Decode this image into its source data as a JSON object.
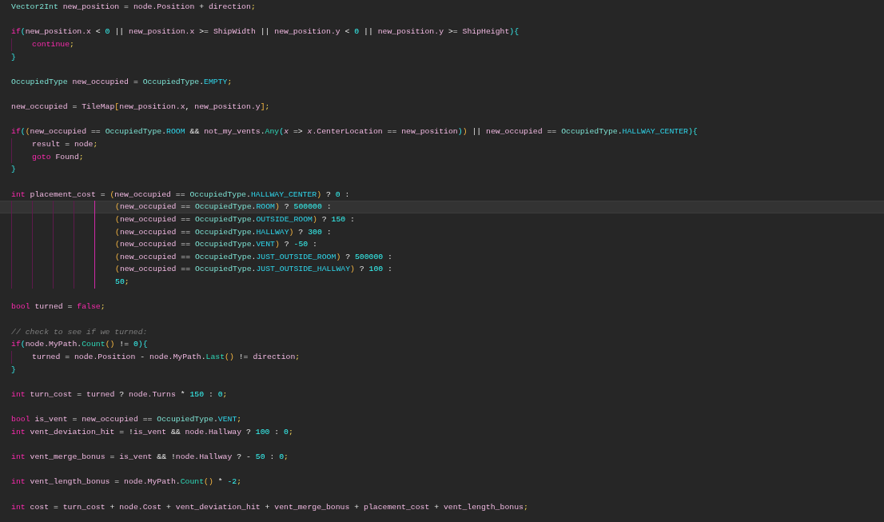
{
  "editor": {
    "lines": [
      {
        "current": false,
        "tokens": [
          {
            "kind": "type",
            "text": "Vector2Int"
          },
          {
            "kind": "id",
            "text": " new_position"
          },
          {
            "kind": "op",
            "text": " = "
          },
          {
            "kind": "id",
            "text": "node.Position"
          },
          {
            "kind": "op",
            "text": " + "
          },
          {
            "kind": "id",
            "text": "direction"
          },
          {
            "kind": "pun",
            "text": ";"
          }
        ]
      },
      {
        "current": false
      },
      {
        "current": false,
        "tokens": [
          {
            "kind": "kw",
            "text": "if"
          },
          {
            "kind": "b2",
            "text": "("
          },
          {
            "kind": "id",
            "text": "new_position.x"
          },
          {
            "kind": "op",
            "text": " < "
          },
          {
            "kind": "num",
            "text": "0"
          },
          {
            "kind": "op",
            "text": " || "
          },
          {
            "kind": "id",
            "text": "new_position.x"
          },
          {
            "kind": "op",
            "text": " >= "
          },
          {
            "kind": "id",
            "text": "ShipWidth"
          },
          {
            "kind": "op",
            "text": " || "
          },
          {
            "kind": "id",
            "text": "new_position.y"
          },
          {
            "kind": "op",
            "text": " < "
          },
          {
            "kind": "num",
            "text": "0"
          },
          {
            "kind": "op",
            "text": " || "
          },
          {
            "kind": "id",
            "text": "new_position.y"
          },
          {
            "kind": "op",
            "text": " >= "
          },
          {
            "kind": "id",
            "text": "ShipHeight"
          },
          {
            "kind": "b2",
            "text": "){"
          }
        ]
      },
      {
        "current": false,
        "guides": [
          {
            "active": false
          }
        ],
        "tokens": [
          {
            "kind": "kw",
            "text": "continue"
          },
          {
            "kind": "pun",
            "text": ";"
          }
        ]
      },
      {
        "current": false,
        "tokens": [
          {
            "kind": "b2",
            "text": "}"
          }
        ]
      },
      {
        "current": false
      },
      {
        "current": false,
        "tokens": [
          {
            "kind": "type",
            "text": "OccupiedType"
          },
          {
            "kind": "id",
            "text": " new_occupied"
          },
          {
            "kind": "op",
            "text": " = "
          },
          {
            "kind": "type",
            "text": "OccupiedType"
          },
          {
            "kind": "op",
            "text": "."
          },
          {
            "kind": "enum",
            "text": "EMPTY"
          },
          {
            "kind": "pun",
            "text": ";"
          }
        ]
      },
      {
        "current": false
      },
      {
        "current": false,
        "tokens": [
          {
            "kind": "id",
            "text": "new_occupied"
          },
          {
            "kind": "op",
            "text": " = "
          },
          {
            "kind": "id",
            "text": "TileMap"
          },
          {
            "kind": "b1",
            "text": "["
          },
          {
            "kind": "id",
            "text": "new_position.x"
          },
          {
            "kind": "op",
            "text": ", "
          },
          {
            "kind": "id",
            "text": "new_position.y"
          },
          {
            "kind": "b1",
            "text": "]"
          },
          {
            "kind": "pun",
            "text": ";"
          }
        ]
      },
      {
        "current": false
      },
      {
        "current": false,
        "tokens": [
          {
            "kind": "kw",
            "text": "if"
          },
          {
            "kind": "b2",
            "text": "("
          },
          {
            "kind": "b1",
            "text": "("
          },
          {
            "kind": "id",
            "text": "new_occupied"
          },
          {
            "kind": "op",
            "text": " == "
          },
          {
            "kind": "type",
            "text": "OccupiedType"
          },
          {
            "kind": "op",
            "text": "."
          },
          {
            "kind": "enum",
            "text": "ROOM"
          },
          {
            "kind": "op",
            "text": " && "
          },
          {
            "kind": "id",
            "text": "not_my_vents"
          },
          {
            "kind": "op",
            "text": "."
          },
          {
            "kind": "fn",
            "text": "Any"
          },
          {
            "kind": "b2",
            "text": "("
          },
          {
            "kind": "param",
            "text": "x"
          },
          {
            "kind": "op",
            "text": " => "
          },
          {
            "kind": "param",
            "text": "x"
          },
          {
            "kind": "id",
            "text": ".CenterLocation"
          },
          {
            "kind": "op",
            "text": " == "
          },
          {
            "kind": "id",
            "text": "new_position"
          },
          {
            "kind": "b2",
            "text": ")"
          },
          {
            "kind": "b1",
            "text": ")"
          },
          {
            "kind": "op",
            "text": " || "
          },
          {
            "kind": "id",
            "text": "new_occupied"
          },
          {
            "kind": "op",
            "text": " == "
          },
          {
            "kind": "type",
            "text": "OccupiedType"
          },
          {
            "kind": "op",
            "text": "."
          },
          {
            "kind": "enum",
            "text": "HALLWAY_CENTER"
          },
          {
            "kind": "b2",
            "text": "){"
          }
        ]
      },
      {
        "current": false,
        "guides": [
          {
            "active": false
          }
        ],
        "tokens": [
          {
            "kind": "id",
            "text": "result"
          },
          {
            "kind": "op",
            "text": " = "
          },
          {
            "kind": "id",
            "text": "node"
          },
          {
            "kind": "pun",
            "text": ";"
          }
        ]
      },
      {
        "current": false,
        "guides": [
          {
            "active": false
          }
        ],
        "tokens": [
          {
            "kind": "kw",
            "text": "goto"
          },
          {
            "kind": "id",
            "text": " Found"
          },
          {
            "kind": "pun",
            "text": ";"
          }
        ]
      },
      {
        "current": false,
        "tokens": [
          {
            "kind": "b2",
            "text": "}"
          }
        ]
      },
      {
        "current": false
      },
      {
        "current": false,
        "tokens": [
          {
            "kind": "kw",
            "text": "int"
          },
          {
            "kind": "id",
            "text": " placement_cost"
          },
          {
            "kind": "op",
            "text": " = "
          },
          {
            "kind": "b1",
            "text": "("
          },
          {
            "kind": "id",
            "text": "new_occupied"
          },
          {
            "kind": "op",
            "text": " == "
          },
          {
            "kind": "type",
            "text": "OccupiedType"
          },
          {
            "kind": "op",
            "text": "."
          },
          {
            "kind": "enum",
            "text": "HALLWAY_CENTER"
          },
          {
            "kind": "b1",
            "text": ")"
          },
          {
            "kind": "op",
            "text": " ? "
          },
          {
            "kind": "num",
            "text": "0"
          },
          {
            "kind": "op",
            "text": " :"
          }
        ]
      },
      {
        "current": true,
        "guides": [
          {
            "active": false
          },
          {
            "active": false
          },
          {
            "active": false
          },
          {
            "active": false
          },
          {
            "active": true
          }
        ],
        "tokens": [
          {
            "kind": "b1",
            "text": "("
          },
          {
            "kind": "id",
            "text": "new_occupied"
          },
          {
            "kind": "op",
            "text": " == "
          },
          {
            "kind": "type",
            "text": "OccupiedType"
          },
          {
            "kind": "op",
            "text": "."
          },
          {
            "kind": "enum",
            "text": "ROOM"
          },
          {
            "kind": "b1",
            "text": ")"
          },
          {
            "kind": "op",
            "text": " ? "
          },
          {
            "kind": "num",
            "text": "500000"
          },
          {
            "kind": "op",
            "text": " :"
          }
        ]
      },
      {
        "current": false,
        "guides": [
          {
            "active": false
          },
          {
            "active": false
          },
          {
            "active": false
          },
          {
            "active": false
          },
          {
            "active": true
          }
        ],
        "tokens": [
          {
            "kind": "b1",
            "text": "("
          },
          {
            "kind": "id",
            "text": "new_occupied"
          },
          {
            "kind": "op",
            "text": " == "
          },
          {
            "kind": "type",
            "text": "OccupiedType"
          },
          {
            "kind": "op",
            "text": "."
          },
          {
            "kind": "enum",
            "text": "OUTSIDE_ROOM"
          },
          {
            "kind": "b1",
            "text": ")"
          },
          {
            "kind": "op",
            "text": " ? "
          },
          {
            "kind": "num",
            "text": "150"
          },
          {
            "kind": "op",
            "text": " :"
          }
        ]
      },
      {
        "current": false,
        "guides": [
          {
            "active": false
          },
          {
            "active": false
          },
          {
            "active": false
          },
          {
            "active": false
          },
          {
            "active": true
          }
        ],
        "tokens": [
          {
            "kind": "b1",
            "text": "("
          },
          {
            "kind": "id",
            "text": "new_occupied"
          },
          {
            "kind": "op",
            "text": " == "
          },
          {
            "kind": "type",
            "text": "OccupiedType"
          },
          {
            "kind": "op",
            "text": "."
          },
          {
            "kind": "enum",
            "text": "HALLWAY"
          },
          {
            "kind": "b1",
            "text": ")"
          },
          {
            "kind": "op",
            "text": " ? "
          },
          {
            "kind": "num",
            "text": "300"
          },
          {
            "kind": "op",
            "text": " :"
          }
        ]
      },
      {
        "current": false,
        "guides": [
          {
            "active": false
          },
          {
            "active": false
          },
          {
            "active": false
          },
          {
            "active": false
          },
          {
            "active": true
          }
        ],
        "tokens": [
          {
            "kind": "b1",
            "text": "("
          },
          {
            "kind": "id",
            "text": "new_occupied"
          },
          {
            "kind": "op",
            "text": " == "
          },
          {
            "kind": "type",
            "text": "OccupiedType"
          },
          {
            "kind": "op",
            "text": "."
          },
          {
            "kind": "enum",
            "text": "VENT"
          },
          {
            "kind": "b1",
            "text": ")"
          },
          {
            "kind": "op",
            "text": " ? "
          },
          {
            "kind": "num",
            "text": "-50"
          },
          {
            "kind": "op",
            "text": " :"
          }
        ]
      },
      {
        "current": false,
        "guides": [
          {
            "active": false
          },
          {
            "active": false
          },
          {
            "active": false
          },
          {
            "active": false
          },
          {
            "active": true
          }
        ],
        "tokens": [
          {
            "kind": "b1",
            "text": "("
          },
          {
            "kind": "id",
            "text": "new_occupied"
          },
          {
            "kind": "op",
            "text": " == "
          },
          {
            "kind": "type",
            "text": "OccupiedType"
          },
          {
            "kind": "op",
            "text": "."
          },
          {
            "kind": "enum",
            "text": "JUST_OUTSIDE_ROOM"
          },
          {
            "kind": "b1",
            "text": ")"
          },
          {
            "kind": "op",
            "text": " ? "
          },
          {
            "kind": "num",
            "text": "500000"
          },
          {
            "kind": "op",
            "text": " :"
          }
        ]
      },
      {
        "current": false,
        "guides": [
          {
            "active": false
          },
          {
            "active": false
          },
          {
            "active": false
          },
          {
            "active": false
          },
          {
            "active": true
          }
        ],
        "tokens": [
          {
            "kind": "b1",
            "text": "("
          },
          {
            "kind": "id",
            "text": "new_occupied"
          },
          {
            "kind": "op",
            "text": " == "
          },
          {
            "kind": "type",
            "text": "OccupiedType"
          },
          {
            "kind": "op",
            "text": "."
          },
          {
            "kind": "enum",
            "text": "JUST_OUTSIDE_HALLWAY"
          },
          {
            "kind": "b1",
            "text": ")"
          },
          {
            "kind": "op",
            "text": " ? "
          },
          {
            "kind": "num",
            "text": "100"
          },
          {
            "kind": "op",
            "text": " :"
          }
        ]
      },
      {
        "current": false,
        "guides": [
          {
            "active": false
          },
          {
            "active": false
          },
          {
            "active": false
          },
          {
            "active": false
          },
          {
            "active": true
          }
        ],
        "tokens": [
          {
            "kind": "num",
            "text": "50"
          },
          {
            "kind": "pun",
            "text": ";"
          }
        ]
      },
      {
        "current": false
      },
      {
        "current": false,
        "tokens": [
          {
            "kind": "kw",
            "text": "bool"
          },
          {
            "kind": "id",
            "text": " turned"
          },
          {
            "kind": "op",
            "text": " = "
          },
          {
            "kind": "kw",
            "text": "false"
          },
          {
            "kind": "pun",
            "text": ";"
          }
        ]
      },
      {
        "current": false
      },
      {
        "current": false,
        "tokens": [
          {
            "kind": "cm",
            "text": "// check to see if we turned:"
          }
        ]
      },
      {
        "current": false,
        "tokens": [
          {
            "kind": "kw",
            "text": "if"
          },
          {
            "kind": "b2",
            "text": "("
          },
          {
            "kind": "id",
            "text": "node.MyPath"
          },
          {
            "kind": "op",
            "text": "."
          },
          {
            "kind": "fn",
            "text": "Count"
          },
          {
            "kind": "b1",
            "text": "()"
          },
          {
            "kind": "op",
            "text": " != "
          },
          {
            "kind": "num",
            "text": "0"
          },
          {
            "kind": "b2",
            "text": "){"
          }
        ]
      },
      {
        "current": false,
        "guides": [
          {
            "active": false
          }
        ],
        "tokens": [
          {
            "kind": "id",
            "text": "turned"
          },
          {
            "kind": "op",
            "text": " = "
          },
          {
            "kind": "id",
            "text": "node.Position"
          },
          {
            "kind": "op",
            "text": " - "
          },
          {
            "kind": "id",
            "text": "node.MyPath"
          },
          {
            "kind": "op",
            "text": "."
          },
          {
            "kind": "fn",
            "text": "Last"
          },
          {
            "kind": "b1",
            "text": "()"
          },
          {
            "kind": "op",
            "text": " != "
          },
          {
            "kind": "id",
            "text": "direction"
          },
          {
            "kind": "pun",
            "text": ";"
          }
        ]
      },
      {
        "current": false,
        "tokens": [
          {
            "kind": "b2",
            "text": "}"
          }
        ]
      },
      {
        "current": false
      },
      {
        "current": false,
        "tokens": [
          {
            "kind": "kw",
            "text": "int"
          },
          {
            "kind": "id",
            "text": " turn_cost"
          },
          {
            "kind": "op",
            "text": " = "
          },
          {
            "kind": "id",
            "text": "turned"
          },
          {
            "kind": "op",
            "text": " ? "
          },
          {
            "kind": "id",
            "text": "node.Turns"
          },
          {
            "kind": "op",
            "text": " * "
          },
          {
            "kind": "num",
            "text": "150"
          },
          {
            "kind": "op",
            "text": " : "
          },
          {
            "kind": "num",
            "text": "0"
          },
          {
            "kind": "pun",
            "text": ";"
          }
        ]
      },
      {
        "current": false
      },
      {
        "current": false,
        "tokens": [
          {
            "kind": "kw",
            "text": "bool"
          },
          {
            "kind": "id",
            "text": " is_vent"
          },
          {
            "kind": "op",
            "text": " = "
          },
          {
            "kind": "id",
            "text": "new_occupied"
          },
          {
            "kind": "op",
            "text": " == "
          },
          {
            "kind": "type",
            "text": "OccupiedType"
          },
          {
            "kind": "op",
            "text": "."
          },
          {
            "kind": "enum",
            "text": "VENT"
          },
          {
            "kind": "pun",
            "text": ";"
          }
        ]
      },
      {
        "current": false,
        "tokens": [
          {
            "kind": "kw",
            "text": "int"
          },
          {
            "kind": "id",
            "text": " vent_deviation_hit"
          },
          {
            "kind": "op",
            "text": " = !"
          },
          {
            "kind": "id",
            "text": "is_vent"
          },
          {
            "kind": "op",
            "text": " && "
          },
          {
            "kind": "id",
            "text": "node.Hallway"
          },
          {
            "kind": "op",
            "text": " ? "
          },
          {
            "kind": "num",
            "text": "100"
          },
          {
            "kind": "op",
            "text": " : "
          },
          {
            "kind": "num",
            "text": "0"
          },
          {
            "kind": "pun",
            "text": ";"
          }
        ]
      },
      {
        "current": false
      },
      {
        "current": false,
        "tokens": [
          {
            "kind": "kw",
            "text": "int"
          },
          {
            "kind": "id",
            "text": " vent_merge_bonus"
          },
          {
            "kind": "op",
            "text": " = "
          },
          {
            "kind": "id",
            "text": "is_vent"
          },
          {
            "kind": "op",
            "text": " && !"
          },
          {
            "kind": "id",
            "text": "node.Hallway"
          },
          {
            "kind": "op",
            "text": " ? - "
          },
          {
            "kind": "num",
            "text": "50"
          },
          {
            "kind": "op",
            "text": " : "
          },
          {
            "kind": "num",
            "text": "0"
          },
          {
            "kind": "pun",
            "text": ";"
          }
        ]
      },
      {
        "current": false
      },
      {
        "current": false,
        "tokens": [
          {
            "kind": "kw",
            "text": "int"
          },
          {
            "kind": "id",
            "text": " vent_length_bonus"
          },
          {
            "kind": "op",
            "text": " = "
          },
          {
            "kind": "id",
            "text": "node.MyPath"
          },
          {
            "kind": "op",
            "text": "."
          },
          {
            "kind": "fn",
            "text": "Count"
          },
          {
            "kind": "b1",
            "text": "()"
          },
          {
            "kind": "op",
            "text": " * "
          },
          {
            "kind": "num",
            "text": "-2"
          },
          {
            "kind": "pun",
            "text": ";"
          }
        ]
      },
      {
        "current": false
      },
      {
        "current": false,
        "tokens": [
          {
            "kind": "kw",
            "text": "int"
          },
          {
            "kind": "id",
            "text": " cost"
          },
          {
            "kind": "op",
            "text": " = "
          },
          {
            "kind": "id",
            "text": "turn_cost"
          },
          {
            "kind": "op",
            "text": " + "
          },
          {
            "kind": "id",
            "text": "node.Cost"
          },
          {
            "kind": "op",
            "text": " + "
          },
          {
            "kind": "id",
            "text": "vent_deviation_hit"
          },
          {
            "kind": "op",
            "text": " + "
          },
          {
            "kind": "id",
            "text": "vent_merge_bonus"
          },
          {
            "kind": "op",
            "text": " + "
          },
          {
            "kind": "id",
            "text": "placement_cost"
          },
          {
            "kind": "op",
            "text": " + "
          },
          {
            "kind": "id",
            "text": "vent_length_bonus"
          },
          {
            "kind": "pun",
            "text": ";"
          }
        ]
      }
    ]
  }
}
